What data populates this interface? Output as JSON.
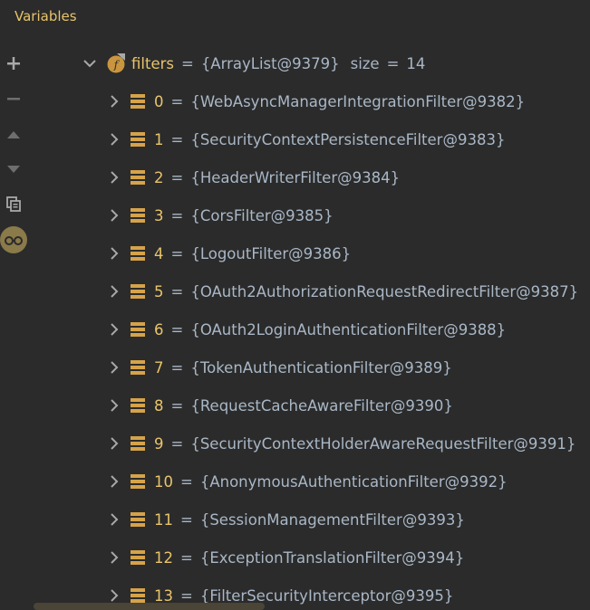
{
  "panel": {
    "title": "Variables"
  },
  "toolbar": {
    "buttons": [
      {
        "name": "add-watch-button",
        "icon": "plus-icon"
      },
      {
        "name": "remove-watch-button",
        "icon": "minus-icon"
      },
      {
        "name": "move-up-button",
        "icon": "triangle-up-icon"
      },
      {
        "name": "move-down-button",
        "icon": "triangle-down-icon"
      },
      {
        "name": "copy-button",
        "icon": "copy-icon"
      },
      {
        "name": "show-watches-button",
        "icon": "glasses-icon"
      }
    ]
  },
  "root": {
    "name": "filters",
    "eq": "=",
    "value": "{ArrayList@9379}",
    "size_label": "size",
    "size_eq": "=",
    "size_value": "14",
    "icon": "field-icon"
  },
  "items": [
    {
      "index": "0",
      "eq": "=",
      "value": "{WebAsyncManagerIntegrationFilter@9382}"
    },
    {
      "index": "1",
      "eq": "=",
      "value": "{SecurityContextPersistenceFilter@9383}"
    },
    {
      "index": "2",
      "eq": "=",
      "value": "{HeaderWriterFilter@9384}"
    },
    {
      "index": "3",
      "eq": "=",
      "value": "{CorsFilter@9385}"
    },
    {
      "index": "4",
      "eq": "=",
      "value": "{LogoutFilter@9386}"
    },
    {
      "index": "5",
      "eq": "=",
      "value": "{OAuth2AuthorizationRequestRedirectFilter@9387}"
    },
    {
      "index": "6",
      "eq": "=",
      "value": "{OAuth2LoginAuthenticationFilter@9388}"
    },
    {
      "index": "7",
      "eq": "=",
      "value": "{TokenAuthenticationFilter@9389}"
    },
    {
      "index": "8",
      "eq": "=",
      "value": "{RequestCacheAwareFilter@9390}"
    },
    {
      "index": "9",
      "eq": "=",
      "value": "{SecurityContextHolderAwareRequestFilter@9391}"
    },
    {
      "index": "10",
      "eq": "=",
      "value": "{AnonymousAuthenticationFilter@9392}"
    },
    {
      "index": "11",
      "eq": "=",
      "value": "{SessionManagementFilter@9393}"
    },
    {
      "index": "12",
      "eq": "=",
      "value": "{ExceptionTranslationFilter@9394}"
    },
    {
      "index": "13",
      "eq": "=",
      "value": "{FilterSecurityInterceptor@9395}"
    }
  ],
  "colors": {
    "background": "#2b2b2b",
    "title": "#e8c46b",
    "index": "#e8c46b",
    "text": "#a9b7c6",
    "array_icon": "#d6a34a",
    "toolbar_icon": "#a9a9a9",
    "chevron": "#a9a9a9"
  }
}
